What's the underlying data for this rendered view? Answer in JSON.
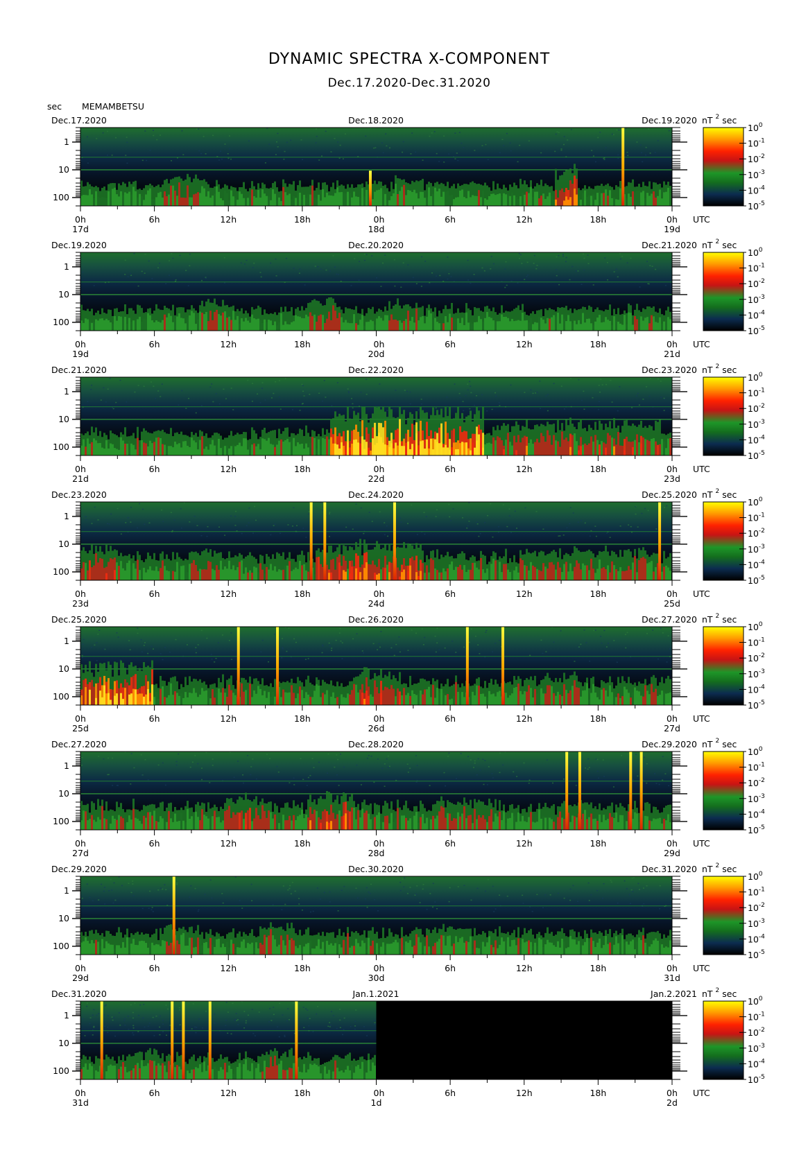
{
  "chart_data": {
    "type": "heatmap",
    "title": "DYNAMIC SPECTRA X-COMPONENT",
    "subtitle": "Dec.17.2020-Dec.31.2020",
    "ylabel": "sec",
    "station": "MEMAMBETSU",
    "y_axis": {
      "scale": "log",
      "direction": "period increasing downward",
      "range_sec": [
        0.3,
        200
      ],
      "tick_labels": [
        "1",
        "10",
        "100"
      ]
    },
    "x_tick_labels": [
      "0h",
      "6h",
      "12h",
      "18h",
      "0h",
      "6h",
      "12h",
      "18h",
      "0h"
    ],
    "x_unit": "UTC",
    "colorbar": {
      "unit": "nT",
      "unit_exponent": "2",
      "unit_suffix": "sec",
      "scale": "log",
      "base": "10",
      "exponents": [
        "0",
        "-1",
        "-2",
        "-3",
        "-4",
        "-5"
      ],
      "colors": [
        "#ffff00",
        "#ff9900",
        "#ff2200",
        "#c81414",
        "#1e9628",
        "#146e1e",
        "#0c2c50",
        "#000000"
      ]
    },
    "panels": [
      {
        "date_left": "Dec.17.2020",
        "date_mid": "Dec.18.2020",
        "date_right": "Dec.19.2020",
        "day_labels": [
          "17d",
          "18d",
          "19d"
        ],
        "data_end": 1.0,
        "activity": 0.28,
        "active_spans": [
          [
            0.14,
            0.2,
            0.5
          ],
          [
            0.53,
            0.58,
            0.4
          ],
          [
            0.8,
            0.84,
            0.7
          ]
        ],
        "spikes": [
          [
            0.49,
            0.45
          ],
          [
            0.917,
            1.0
          ]
        ]
      },
      {
        "date_left": "Dec.19.2020",
        "date_mid": "Dec.20.2020",
        "date_right": "Dec.21.2020",
        "day_labels": [
          "19d",
          "20d",
          "21d"
        ],
        "data_end": 1.0,
        "activity": 0.3,
        "active_spans": [
          [
            0.2,
            0.26,
            0.45
          ],
          [
            0.38,
            0.44,
            0.5
          ],
          [
            0.52,
            0.58,
            0.45
          ]
        ],
        "spikes": []
      },
      {
        "date_left": "Dec.21.2020",
        "date_mid": "Dec.22.2020",
        "date_right": "Dec.23.2020",
        "day_labels": [
          "21d",
          "22d",
          "23d"
        ],
        "data_end": 1.0,
        "activity": 0.35,
        "active_spans": [
          [
            0.42,
            0.68,
            1.0
          ],
          [
            0.7,
            0.98,
            0.6
          ]
        ],
        "spikes": []
      },
      {
        "date_left": "Dec.23.2020",
        "date_mid": "Dec.24.2020",
        "date_right": "Dec.25.2020",
        "day_labels": [
          "23d",
          "24d",
          "25d"
        ],
        "data_end": 1.0,
        "activity": 0.4,
        "active_spans": [
          [
            0.0,
            0.06,
            0.6
          ],
          [
            0.18,
            0.23,
            0.5
          ],
          [
            0.4,
            0.58,
            0.7
          ],
          [
            0.74,
            0.98,
            0.5
          ]
        ],
        "spikes": [
          [
            0.39,
            1.0
          ],
          [
            0.413,
            1.0
          ],
          [
            0.531,
            1.0
          ],
          [
            0.979,
            1.0
          ]
        ]
      },
      {
        "date_left": "Dec.25.2020",
        "date_mid": "Dec.26.2020",
        "date_right": "Dec.27.2020",
        "day_labels": [
          "25d",
          "26d",
          "27d"
        ],
        "data_end": 1.0,
        "activity": 0.38,
        "active_spans": [
          [
            0.0,
            0.12,
            0.8
          ],
          [
            0.46,
            0.54,
            0.6
          ],
          [
            0.78,
            0.84,
            0.5
          ]
        ],
        "spikes": [
          [
            0.267,
            1.0
          ],
          [
            0.333,
            1.0
          ],
          [
            0.654,
            1.0
          ],
          [
            0.714,
            1.0
          ]
        ]
      },
      {
        "date_left": "Dec.27.2020",
        "date_mid": "Dec.28.2020",
        "date_right": "Dec.29.2020",
        "day_labels": [
          "27d",
          "28d",
          "29d"
        ],
        "data_end": 1.0,
        "activity": 0.38,
        "active_spans": [
          [
            0.24,
            0.32,
            0.6
          ],
          [
            0.38,
            0.46,
            0.65
          ],
          [
            0.6,
            0.7,
            0.5
          ]
        ],
        "spikes": [
          [
            0.822,
            1.0
          ],
          [
            0.844,
            1.0
          ],
          [
            0.93,
            1.0
          ],
          [
            0.948,
            1.0
          ]
        ]
      },
      {
        "date_left": "Dec.29.2020",
        "date_mid": "Dec.30.2020",
        "date_right": "Dec.31.2020",
        "day_labels": [
          "29d",
          "30d",
          "31d"
        ],
        "data_end": 1.0,
        "activity": 0.32,
        "active_spans": [
          [
            0.14,
            0.2,
            0.45
          ],
          [
            0.3,
            0.36,
            0.5
          ],
          [
            0.6,
            0.66,
            0.4
          ]
        ],
        "spikes": [
          [
            0.158,
            1.0
          ]
        ]
      },
      {
        "date_left": "Dec.31.2020",
        "date_mid": "Jan.1.2021",
        "date_right": "Jan.2.2021",
        "day_labels": [
          "31d",
          "1d",
          "2d"
        ],
        "data_end": 0.5,
        "activity": 0.3,
        "active_spans": [
          [
            0.08,
            0.14,
            0.45
          ],
          [
            0.3,
            0.36,
            0.45
          ]
        ],
        "spikes": [
          [
            0.036,
            1.0
          ],
          [
            0.155,
            1.0
          ],
          [
            0.174,
            1.0
          ],
          [
            0.219,
            1.0
          ],
          [
            0.365,
            1.0
          ]
        ]
      }
    ]
  }
}
